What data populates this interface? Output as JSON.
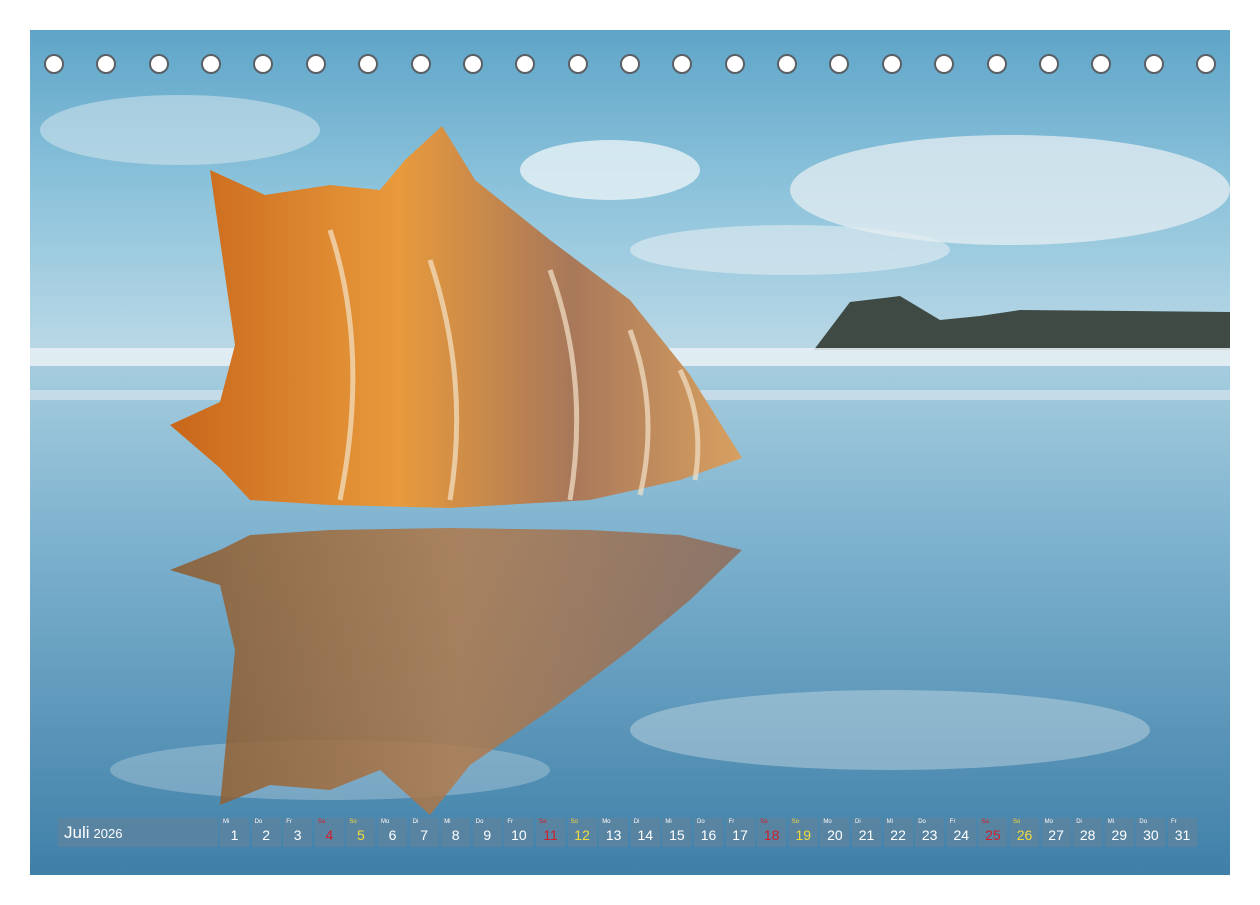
{
  "calendar": {
    "month": "Juli",
    "year": "2026",
    "days": [
      {
        "num": "1",
        "dow": "Mi",
        "type": "weekday"
      },
      {
        "num": "2",
        "dow": "Do",
        "type": "weekday"
      },
      {
        "num": "3",
        "dow": "Fr",
        "type": "weekday"
      },
      {
        "num": "4",
        "dow": "Sa",
        "type": "sun"
      },
      {
        "num": "5",
        "dow": "So",
        "type": "sat"
      },
      {
        "num": "6",
        "dow": "Mo",
        "type": "weekday"
      },
      {
        "num": "7",
        "dow": "Di",
        "type": "weekday"
      },
      {
        "num": "8",
        "dow": "Mi",
        "type": "weekday"
      },
      {
        "num": "9",
        "dow": "Do",
        "type": "weekday"
      },
      {
        "num": "10",
        "dow": "Fr",
        "type": "weekday"
      },
      {
        "num": "11",
        "dow": "Sa",
        "type": "sun"
      },
      {
        "num": "12",
        "dow": "So",
        "type": "sat"
      },
      {
        "num": "13",
        "dow": "Mo",
        "type": "weekday"
      },
      {
        "num": "14",
        "dow": "Di",
        "type": "weekday"
      },
      {
        "num": "15",
        "dow": "Mi",
        "type": "weekday"
      },
      {
        "num": "16",
        "dow": "Do",
        "type": "weekday"
      },
      {
        "num": "17",
        "dow": "Fr",
        "type": "weekday"
      },
      {
        "num": "18",
        "dow": "Sa",
        "type": "sun"
      },
      {
        "num": "19",
        "dow": "So",
        "type": "sat"
      },
      {
        "num": "20",
        "dow": "Mo",
        "type": "weekday"
      },
      {
        "num": "21",
        "dow": "Di",
        "type": "weekday"
      },
      {
        "num": "22",
        "dow": "Mi",
        "type": "weekday"
      },
      {
        "num": "23",
        "dow": "Do",
        "type": "weekday"
      },
      {
        "num": "24",
        "dow": "Fr",
        "type": "weekday"
      },
      {
        "num": "25",
        "dow": "Sa",
        "type": "sun"
      },
      {
        "num": "26",
        "dow": "So",
        "type": "sat"
      },
      {
        "num": "27",
        "dow": "Mo",
        "type": "weekday"
      },
      {
        "num": "28",
        "dow": "Di",
        "type": "weekday"
      },
      {
        "num": "29",
        "dow": "Mi",
        "type": "weekday"
      },
      {
        "num": "30",
        "dow": "Do",
        "type": "weekday"
      },
      {
        "num": "31",
        "dow": "Fr",
        "type": "weekday"
      }
    ]
  },
  "binding": {
    "hole_count": 23
  },
  "colors": {
    "bar": "#5c84a0",
    "saturday": "#f2dc3a",
    "sunday": "#d01f2a",
    "text": "#ffffff"
  }
}
